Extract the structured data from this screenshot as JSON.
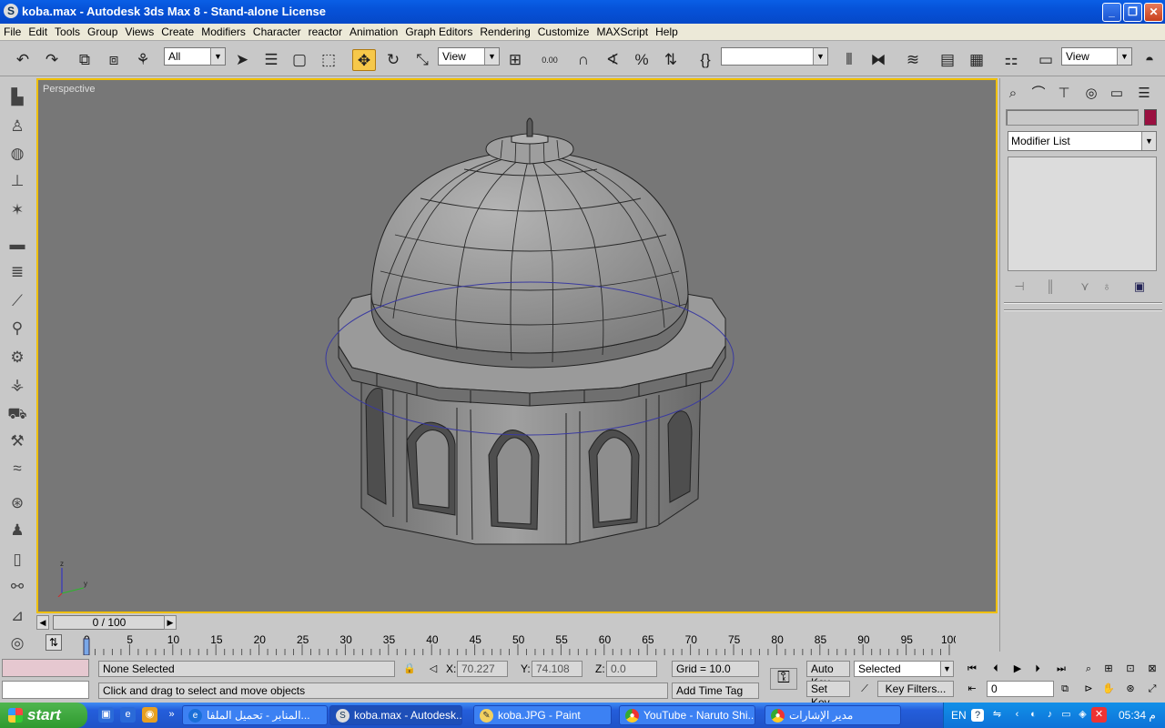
{
  "window": {
    "title": "koba.max - Autodesk 3ds Max 8  - Stand-alone License",
    "min": "_",
    "max": "❐",
    "close": "✕"
  },
  "menu": [
    "File",
    "Edit",
    "Tools",
    "Group",
    "Views",
    "Create",
    "Modifiers",
    "Character",
    "reactor",
    "Animation",
    "Graph Editors",
    "Rendering",
    "Customize",
    "MAXScript",
    "Help"
  ],
  "toolbar": {
    "filter_value": "All",
    "ref_coord_value": "View",
    "named_sel_value": "",
    "view_value": "View",
    "spinner_label": "0.00"
  },
  "viewport": {
    "label": "Perspective"
  },
  "command_panel": {
    "modifier_list": "Modifier List",
    "color": "#9a1040"
  },
  "time": {
    "slider": "0 / 100",
    "ticks": [
      "0",
      "5",
      "10",
      "15",
      "20",
      "25",
      "30",
      "35",
      "40",
      "45",
      "50",
      "55",
      "60",
      "65",
      "70",
      "75",
      "80",
      "85",
      "90",
      "95",
      "100"
    ]
  },
  "status": {
    "selection": "None Selected",
    "prompt": "Click and drag to select and move objects",
    "x_label": "X:",
    "x_value": "70.227",
    "y_label": "Y:",
    "y_value": "74.108",
    "z_label": "Z:",
    "z_value": "0.0",
    "grid": "Grid = 10.0",
    "add_time_tag": "Add Time Tag",
    "auto_key": "Auto Key",
    "set_key": "Set Key",
    "key_mode": "Selected",
    "key_filters": "Key Filters...",
    "frame": "0"
  },
  "taskbar": {
    "start": "start",
    "tasks": [
      {
        "label": "المنابر - تحميل الملفا...",
        "icon": "ie-icon"
      },
      {
        "label": "koba.max - Autodesk...",
        "icon": "max-icon"
      },
      {
        "label": "koba.JPG - Paint",
        "icon": "paint-icon"
      },
      {
        "label": "YouTube - Naruto Shi...",
        "icon": "chrome-icon"
      },
      {
        "label": "مدير الإشارات",
        "icon": "chrome-icon"
      }
    ],
    "lang": "EN",
    "clock": "05:34 م"
  }
}
